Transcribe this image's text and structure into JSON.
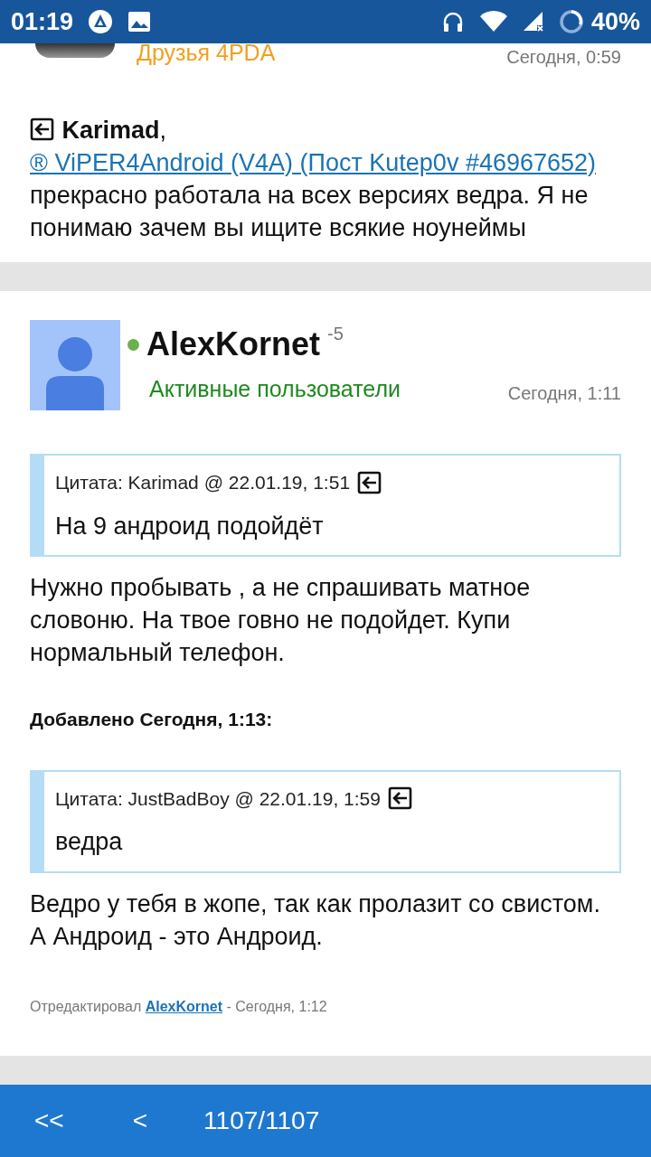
{
  "status_bar": {
    "time": "01:19",
    "battery": "40%"
  },
  "posts": [
    {
      "cut_top": true,
      "group": "Друзья 4PDA",
      "color": "#f0a020",
      "date": "Сегодня, 0:59",
      "blocks": [
        {
          "kind": "reply",
          "author": "Karimad",
          "separator": ", ",
          "link": "® ViPER4Android (V4A) (Пост Kutep0v #46967652)",
          "text": " прекрасно работала на всех версиях ведра. Я не понимаю зачем вы ищите всякие ноунеймы"
        }
      ]
    },
    {
      "cut_top": false,
      "author": "AlexKornet",
      "reputation": "-5",
      "online": true,
      "group": "Активные пользователи",
      "color": "#1e8a1e",
      "date": "Сегодня, 1:11",
      "blocks": [
        {
          "kind": "quote",
          "header": "Цитата: Karimad @ 22.01.19, 1:51",
          "text": "На 9 андроид подойдёт"
        },
        {
          "kind": "text",
          "text": "Нужно пробывать , а не спрашивать матное словоню. На твое говно  не подойдет. Купи нормальный телефон."
        },
        {
          "kind": "added",
          "text": "Добавлено Сегодня, 1:13:"
        },
        {
          "kind": "quote",
          "header": "Цитата: JustBadBoy @ 22.01.19, 1:59",
          "text": "ведра"
        },
        {
          "kind": "text",
          "text": "Ведро у тебя в жопе, так как пролазит со свистом. А Андроид - это Андроид."
        }
      ],
      "edited": {
        "prefix": "Отредактировал",
        "user": "AlexKornet",
        "suffix": " - Сегодня, 1:12"
      }
    }
  ],
  "bottom_bar": {
    "buttons": [
      "<<",
      "<"
    ],
    "page": "1107/1107"
  }
}
